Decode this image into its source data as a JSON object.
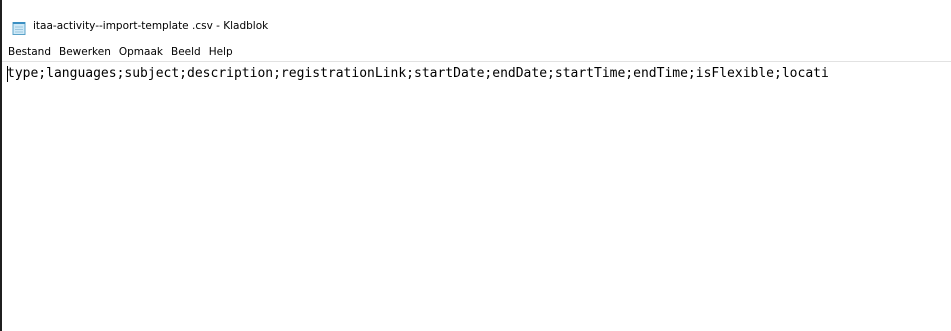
{
  "window": {
    "title": "itaa-activity--import-template .csv - Kladblok",
    "app_icon": "notepad-icon"
  },
  "menu": {
    "items": [
      {
        "label": "Bestand"
      },
      {
        "label": "Bewerken"
      },
      {
        "label": "Opmaak"
      },
      {
        "label": "Beeld"
      },
      {
        "label": "Help"
      }
    ]
  },
  "editor": {
    "content": "type;languages;subject;description;registrationLink;startDate;endDate;startTime;endTime;isFlexible;locati"
  }
}
